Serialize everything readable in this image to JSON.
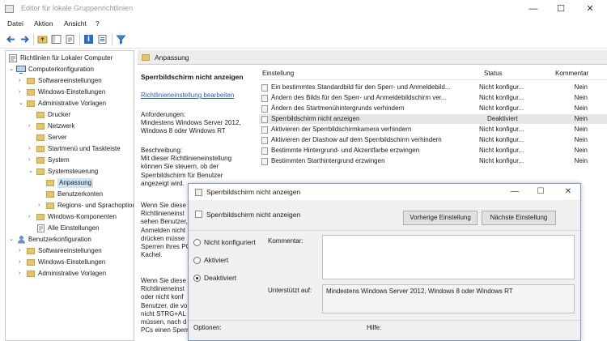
{
  "window": {
    "title": "Editor für lokale Gruppenrichtlinien",
    "min": "—",
    "max": "☐",
    "close": "✕"
  },
  "menu": [
    "Datei",
    "Aktion",
    "Ansicht",
    "?"
  ],
  "toolbar": [
    "back-icon",
    "forward-icon",
    "up-folder-icon",
    "show-tree-icon",
    "export-icon",
    "help-icon",
    "properties-icon",
    "filter-icon"
  ],
  "tree": {
    "root": "Richtlinien für Lokaler Computer",
    "items": [
      {
        "label": "Computerkonfiguration",
        "expander": "⌄"
      },
      {
        "label": "Softwareeinstellungen",
        "expander": "›"
      },
      {
        "label": "Windows-Einstellungen",
        "expander": "›"
      },
      {
        "label": "Administrative Vorlagen",
        "expander": "⌄"
      },
      {
        "label": "Drucker",
        "expander": ""
      },
      {
        "label": "Netzwerk",
        "expander": "›"
      },
      {
        "label": "Server",
        "expander": ""
      },
      {
        "label": "Startmenü und Taskleiste",
        "expander": "›"
      },
      {
        "label": "System",
        "expander": "›"
      },
      {
        "label": "Systemsteuerung",
        "expander": "⌄"
      },
      {
        "label": "Anpassung",
        "expander": ""
      },
      {
        "label": "Benutzerkonten",
        "expander": ""
      },
      {
        "label": "Regions- und Sprachoptionen",
        "expander": "›"
      },
      {
        "label": "Windows-Komponenten",
        "expander": "›"
      },
      {
        "label": "Alle Einstellungen",
        "expander": ""
      },
      {
        "label": "Benutzerkonfiguration",
        "expander": "⌄"
      },
      {
        "label": "Softwareeinstellungen",
        "expander": "›"
      },
      {
        "label": "Windows-Einstellungen",
        "expander": "›"
      },
      {
        "label": "Administrative Vorlagen",
        "expander": "›"
      }
    ]
  },
  "content": {
    "header": "Anpassung",
    "description": {
      "title": "Sperrbildschirm nicht anzeigen",
      "link": "Richtlinieneinstellung bearbeiten",
      "requirements": "Anforderungen:\nMindestens Windows Server 2012, Windows 8 oder Windows RT",
      "description": "Beschreibung:\nMit dieser Richtlinieneinstellung können Sie steuern, ob der Sperrbildschirm für Benutzer angezeigt wird.",
      "para2": "Wenn Sie diese\nRichtlinieneinst\nsehen Benutzer,\nAnmelden nicht\ndrücken müsse\nSperren ihres PC\nKachel.",
      "para3": "Wenn Sie diese\nRichtlinieneinst\noder nicht konf\nBenutzer, die vo\nnicht STRG+AL\nmüssen, nach d\nPCs einen Sperr"
    },
    "columns": {
      "name": "Einstellung",
      "status": "Status",
      "comment": "Kommentar"
    },
    "rows": [
      {
        "name": "Ein bestimmtes Standardbild für den Sperr- und Anmeldebild...",
        "status": "Nicht konfigur...",
        "comment": "Nein"
      },
      {
        "name": "Ändern des Bilds für den Sperr- und Anmeldebildschirm ver...",
        "status": "Nicht konfigur...",
        "comment": "Nein"
      },
      {
        "name": "Ändern des Startmenühintergrunds verhindern",
        "status": "Nicht konfigur...",
        "comment": "Nein"
      },
      {
        "name": "Sperrbildschirm nicht anzeigen",
        "status": "Deaktiviert",
        "comment": "Nein"
      },
      {
        "name": "Aktivieren der Sperrbildschirmkamera verhindern",
        "status": "Nicht konfigur...",
        "comment": "Nein"
      },
      {
        "name": "Aktivieren der Diashow auf dem Sperrbildschirm verhindern",
        "status": "Nicht konfigur...",
        "comment": "Nein"
      },
      {
        "name": "Bestimmte Hintergrund- und Akzentfarbe erzwingen",
        "status": "Nicht konfigur...",
        "comment": "Nein"
      },
      {
        "name": "Bestimmten Starthintergrund erzwingen",
        "status": "Nicht konfigur...",
        "comment": "Nein"
      }
    ]
  },
  "dialog": {
    "title": "Sperrbildschirm nicht anzeigen",
    "subtitle": "Sperrbildschirm nicht anzeigen",
    "prev_button": "Vorherige Einstellung",
    "next_button": "Nächste Einstellung",
    "options": [
      {
        "label": "Nicht konfiguriert",
        "checked": false
      },
      {
        "label": "Aktiviert",
        "checked": false
      },
      {
        "label": "Deaktiviert",
        "checked": true
      }
    ],
    "comment_label": "Kommentar:",
    "comment_value": "",
    "supported_label": "Unterstützt auf:",
    "supported_value": "Mindestens Windows Server 2012, Windows 8 oder Windows RT",
    "options_label": "Optionen:",
    "help_label": "Hilfe:"
  }
}
